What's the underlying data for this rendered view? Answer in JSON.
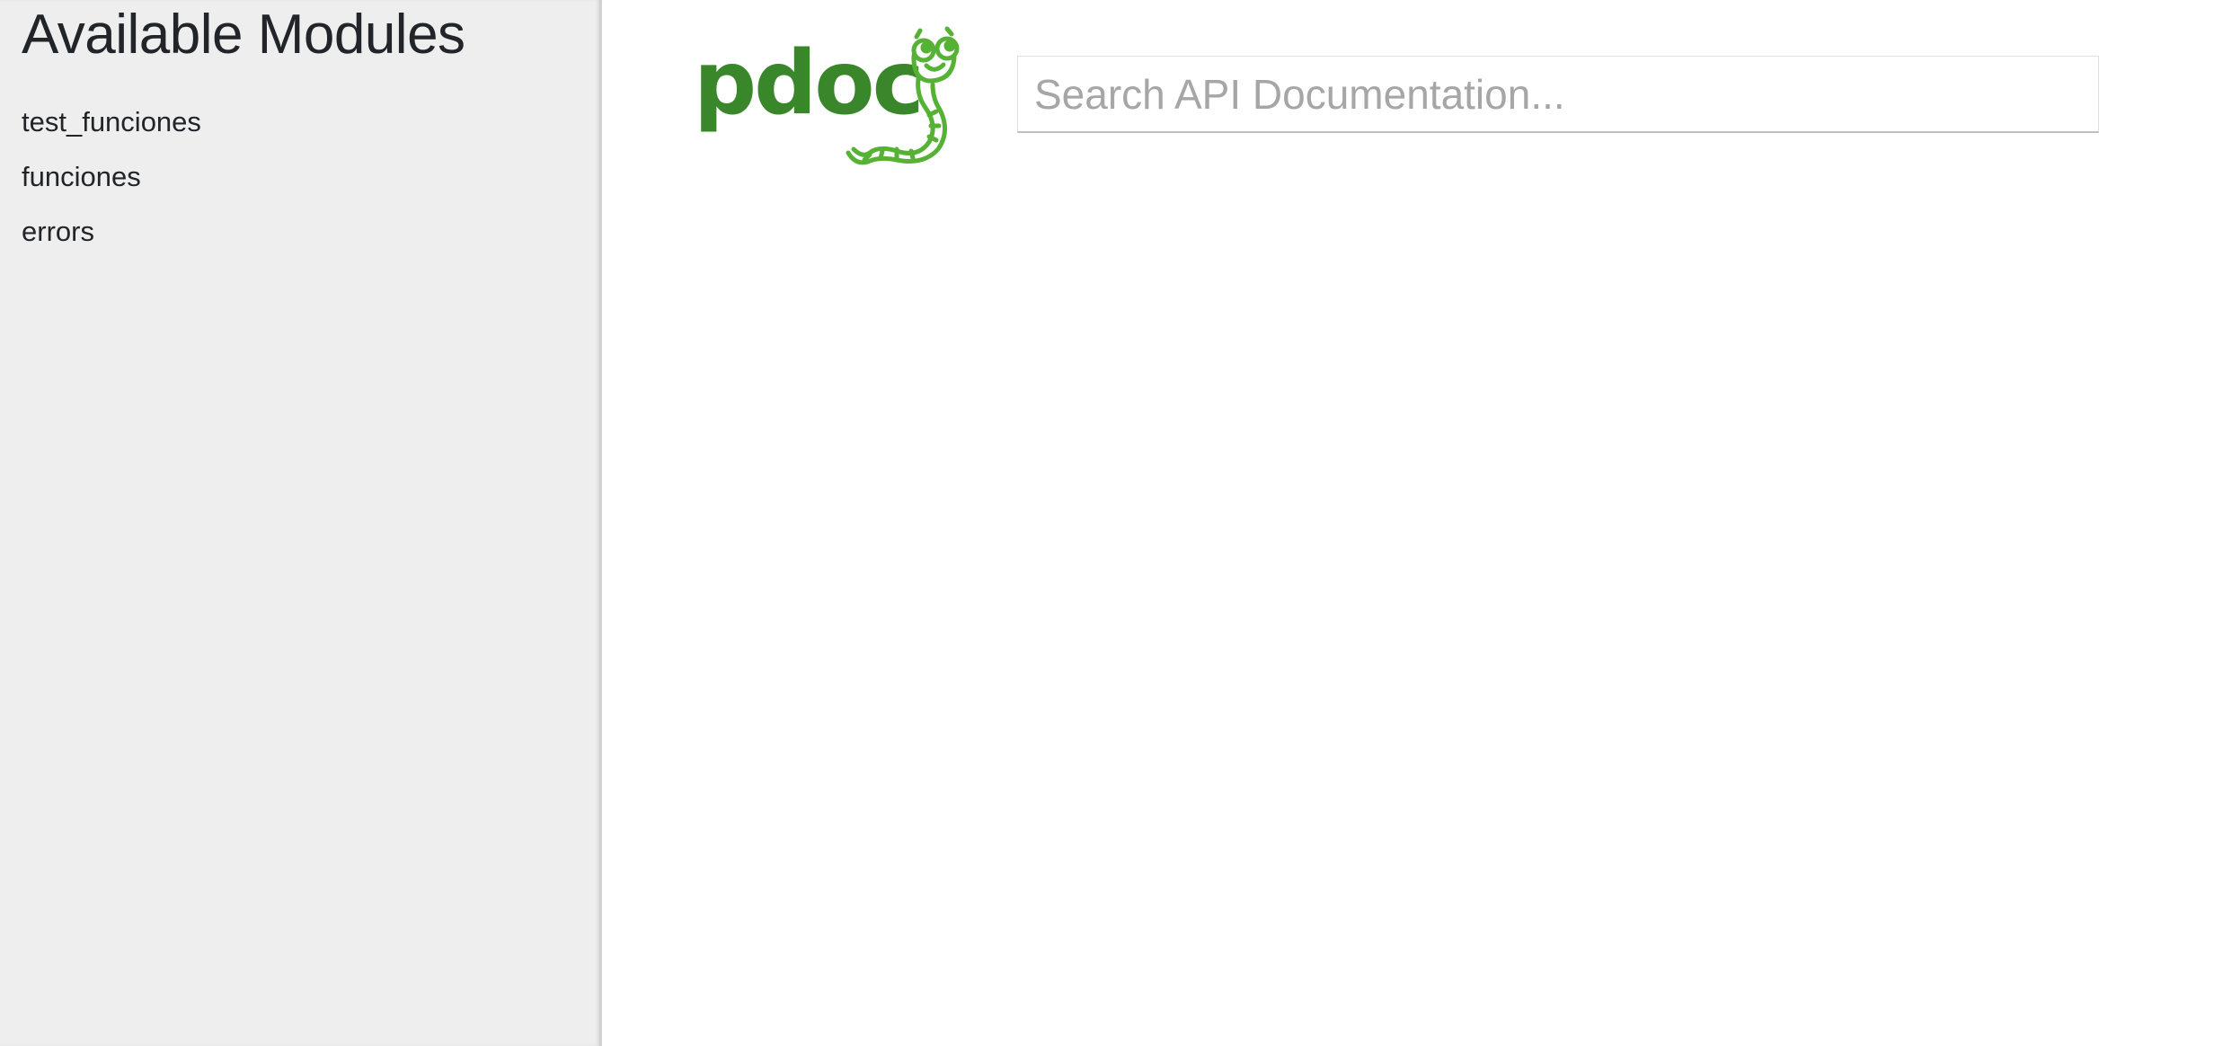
{
  "sidebar": {
    "title": "Available Modules",
    "modules": [
      {
        "label": "test_funciones"
      },
      {
        "label": "funciones"
      },
      {
        "label": "errors"
      }
    ]
  },
  "header": {
    "logo_text": "pdoc",
    "logo_color": "#3a862b",
    "mascot_color": "#56b234"
  },
  "search": {
    "value": "",
    "placeholder": "Search API Documentation..."
  }
}
